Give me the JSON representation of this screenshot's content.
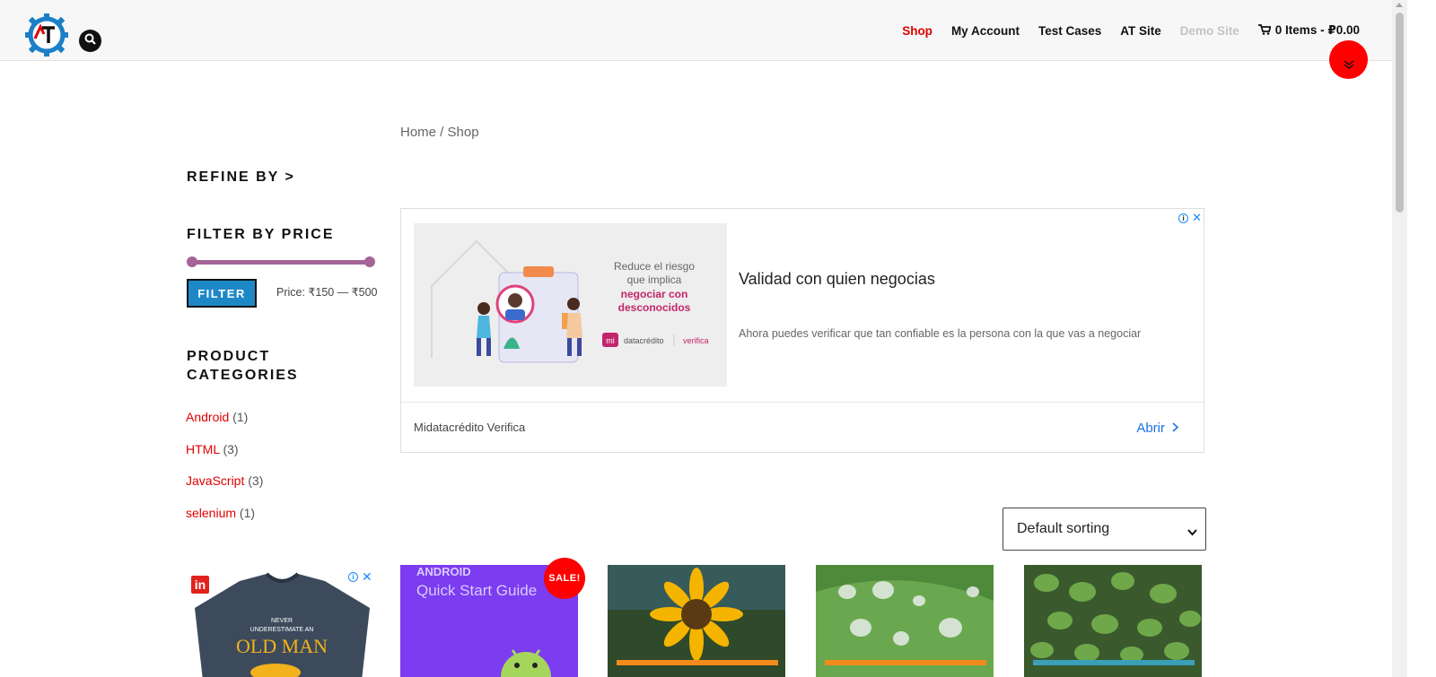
{
  "header": {
    "nav": [
      {
        "label": "Shop",
        "state": "active"
      },
      {
        "label": "My Account",
        "state": "normal"
      },
      {
        "label": "Test Cases",
        "state": "normal"
      },
      {
        "label": "AT Site",
        "state": "normal"
      },
      {
        "label": "Demo Site",
        "state": "muted"
      }
    ],
    "cart_label": "0 Items - ₽0.00"
  },
  "breadcrumb": "Home / Shop",
  "sidebar": {
    "refine_heading": "REFINE BY >",
    "price_heading": "FILTER BY PRICE",
    "filter_button": "FILTER",
    "price_range": "Price: ₹150 — ₹500",
    "categories_heading_line1": "PRODUCT",
    "categories_heading_line2": "CATEGORIES",
    "categories": [
      {
        "name": "Android",
        "count": "(1)"
      },
      {
        "name": "HTML",
        "count": "(3)"
      },
      {
        "name": "JavaScript",
        "count": "(3)"
      },
      {
        "name": "selenium",
        "count": "(1)"
      }
    ],
    "side_ad": {
      "shirt_line1": "NEVER",
      "shirt_line2": "UNDERESTIMATE AN",
      "shirt_line3": "OLD MAN"
    }
  },
  "ad": {
    "image_text_1": "Reduce el riesgo",
    "image_text_2": "que implica",
    "image_text_3": "negociar con",
    "image_text_4": "desconocidos",
    "image_brand": "datacrédito",
    "image_brand_2": "verifica",
    "title": "Validad con quien negocias",
    "description": "Ahora puedes verificar que tan confiable es la persona con la que vas a negociar",
    "advertiser": "Midatacrédito Verifica",
    "open_label": "Abrir"
  },
  "sort": {
    "selected": "Default sorting"
  },
  "products": [
    {
      "thumb_text_1": "ANDROID",
      "thumb_text_2": "Quick Start Guide",
      "badge": "SALE!"
    },
    {
      "thumb": "sunflower"
    },
    {
      "thumb": "water-drops"
    },
    {
      "thumb": "leaves"
    }
  ],
  "colors": {
    "accent_red": "#e00000",
    "slider_purple": "#a46497",
    "filter_blue": "#1e88c7",
    "link_blue": "#1a73e8"
  }
}
